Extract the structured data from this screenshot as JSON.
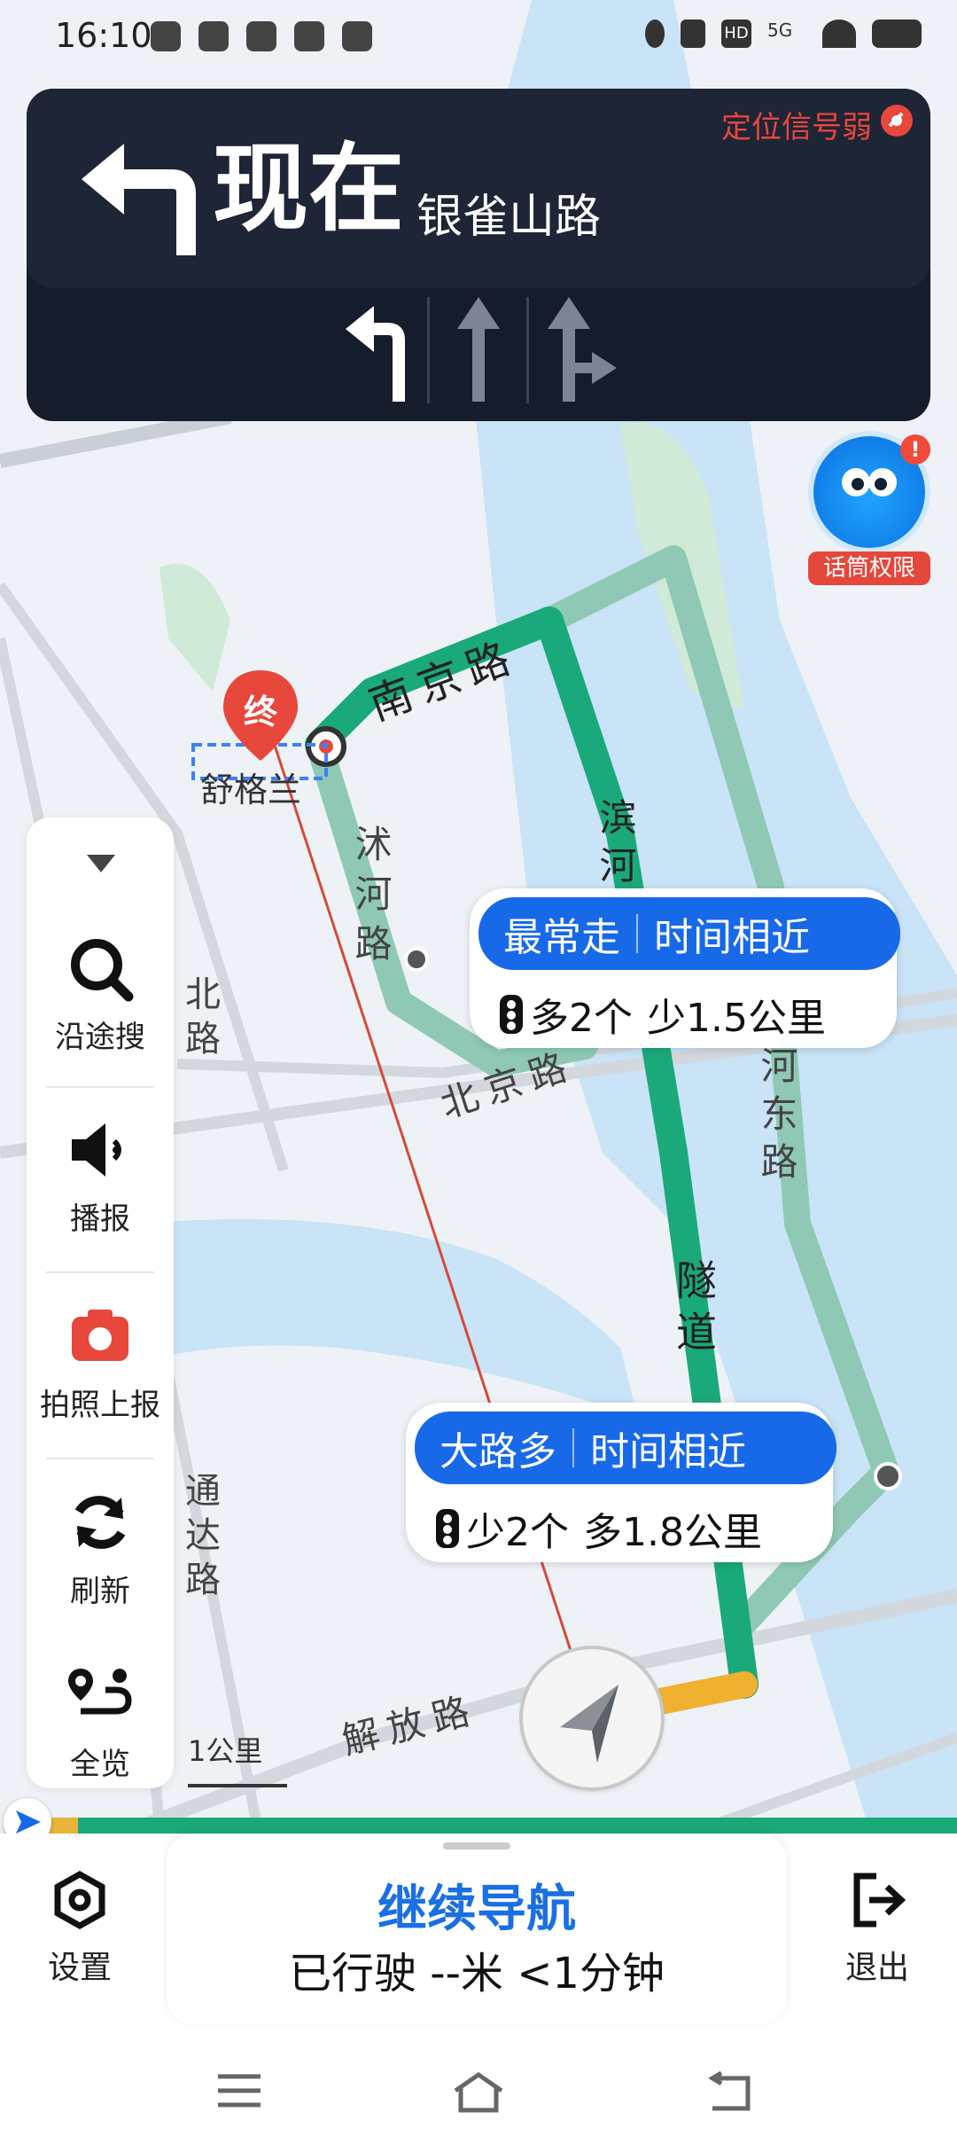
{
  "status_bar": {
    "time": "16:10",
    "network": "5G",
    "hd_badge": "HD"
  },
  "guidance": {
    "turn_direction": "turn-left",
    "distance_text": "现在",
    "road_name": "银雀山路",
    "signal_warning": "定位信号弱",
    "lanes": [
      "turn-left",
      "straight",
      "straight-or-right"
    ]
  },
  "voice_assistant": {
    "badge": "!",
    "label": "话筒权限"
  },
  "map": {
    "roads": [
      "南京路",
      "沭河路",
      "北京路",
      "滨河路",
      "河东路",
      "隧道",
      "解放路",
      "通达路",
      "北路"
    ],
    "destination_marker": "终",
    "destination_name": "舒格兰",
    "scale": "1公里"
  },
  "route_bubbles": [
    {
      "tag": "最常走",
      "summary": "时间相近",
      "traffic_light_delta": "多2个",
      "distance_delta": "少1.5公里"
    },
    {
      "tag": "大路多",
      "summary": "时间相近",
      "traffic_light_delta": "少2个",
      "distance_delta": "多1.8公里"
    }
  ],
  "side_panel": {
    "items": [
      {
        "label": "沿途搜",
        "icon": "search-icon"
      },
      {
        "label": "播报",
        "icon": "speaker-icon"
      },
      {
        "label": "拍照上报",
        "icon": "camera-icon"
      },
      {
        "label": "刷新",
        "icon": "refresh-icon"
      },
      {
        "label": "全览",
        "icon": "route-overview-icon"
      }
    ]
  },
  "bottom_bar": {
    "settings_label": "设置",
    "continue_label": "继续导航",
    "status": "已行驶 --米 <1分钟",
    "exit_label": "退出"
  },
  "colors": {
    "accent": "#1769e8",
    "route_primary": "#1aa97a",
    "route_alt": "#8fc9b5",
    "warning": "#e8473c",
    "nav_card": "#151c2b"
  }
}
